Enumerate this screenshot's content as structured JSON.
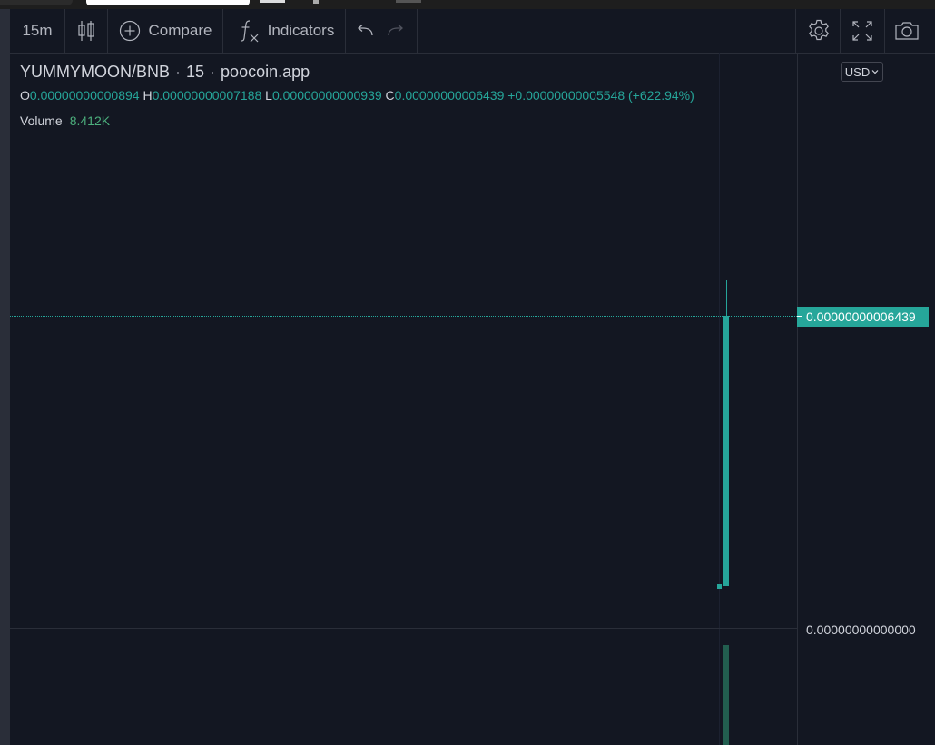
{
  "toolbar": {
    "interval": "15m",
    "compare_label": "Compare",
    "indicators_label": "Indicators"
  },
  "legend": {
    "symbol": "YUMMYMOON/BNB",
    "interval": "15",
    "source": "poocoin.app",
    "o_label": "O",
    "o_value": "0.00000000000894",
    "h_label": "H",
    "h_value": "0.00000000007188",
    "l_label": "L",
    "l_value": "0.00000000000939",
    "c_label": "C",
    "c_value": "0.00000000006439",
    "change": "+0.00000000005548 (+622.94%)",
    "volume_label": "Volume",
    "volume_value": "8.412K"
  },
  "price_scale": {
    "currency": "USD",
    "last_price": "0.00000000006439",
    "bottom_tick": "0.00000000000000"
  },
  "colors": {
    "background": "#131722",
    "up": "#26a69a",
    "volume": "#225e4f",
    "grid": "#2a2e39"
  },
  "icons": [
    "candles-icon",
    "add-circle-icon",
    "fx-icon",
    "undo-icon",
    "redo-icon",
    "gear-icon",
    "fullscreen-icon",
    "camera-icon"
  ]
}
